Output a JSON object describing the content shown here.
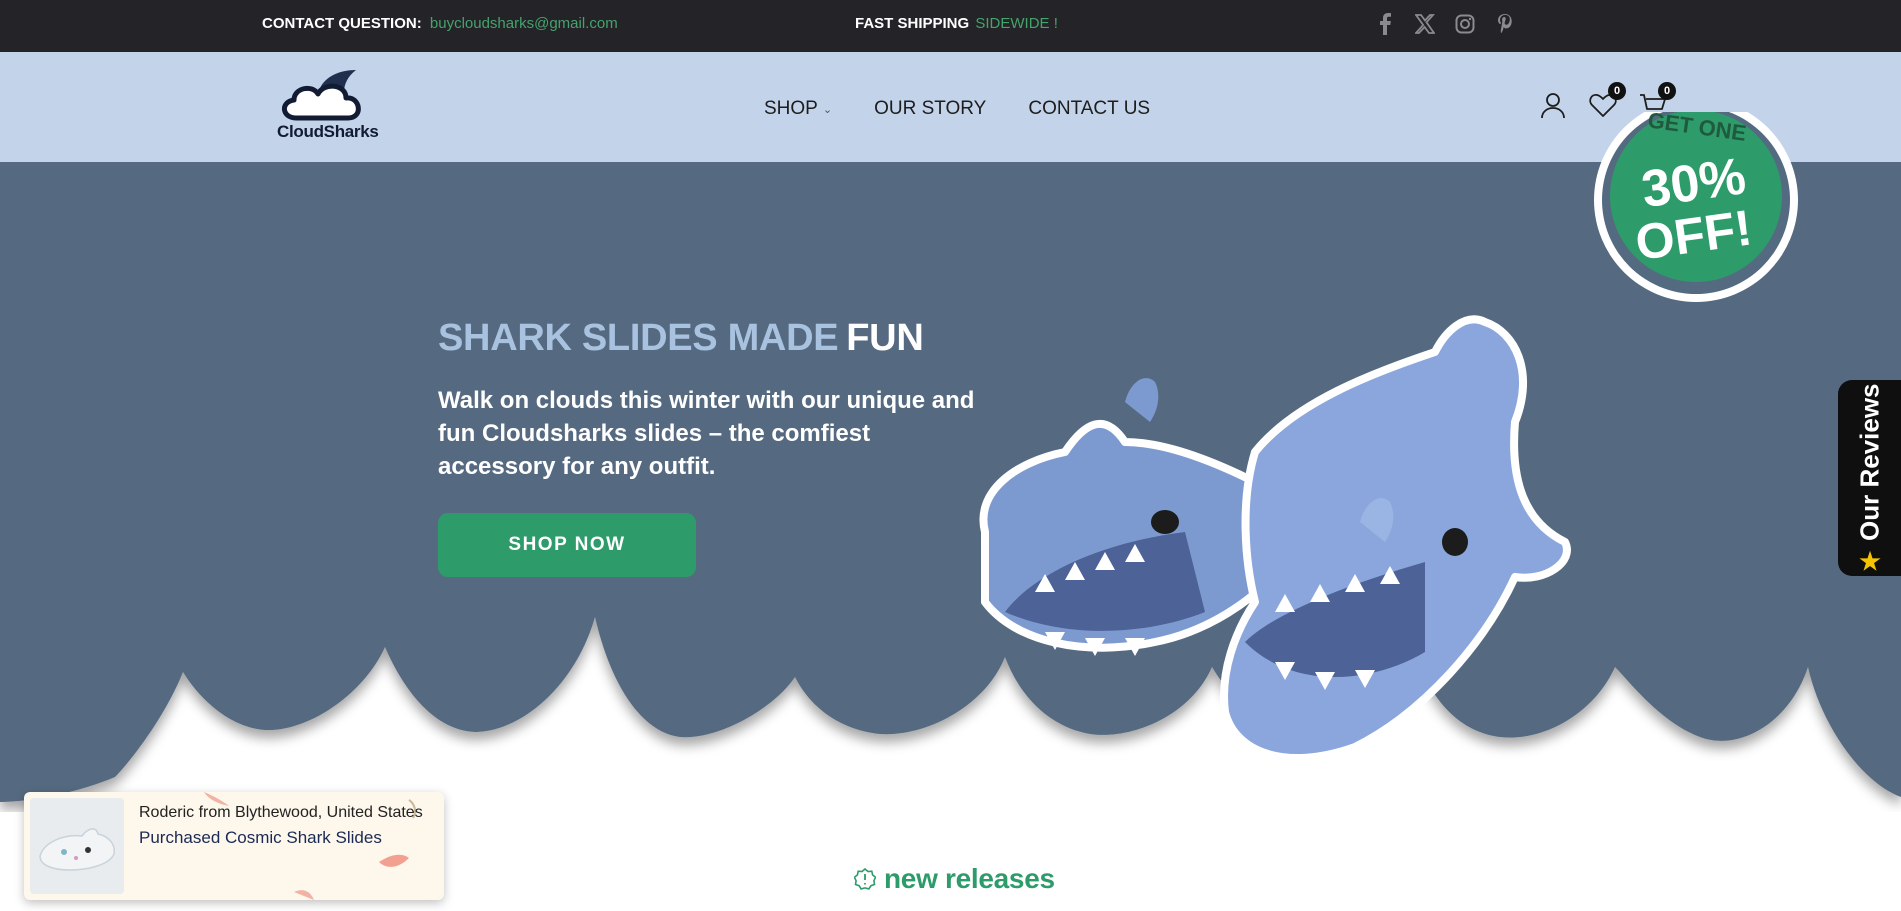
{
  "topbar": {
    "contact_label": "CONTACT QUESTION:",
    "contact_email": "buycloudsharks@gmail.com",
    "shipping_label": "FAST SHIPPING",
    "shipping_highlight": "SIDEWIDE !",
    "social_icons": [
      "facebook-icon",
      "x-twitter-icon",
      "instagram-icon",
      "pinterest-icon"
    ]
  },
  "header": {
    "logo_text": "CloudSharks",
    "nav": [
      {
        "label": "SHOP",
        "has_dropdown": true
      },
      {
        "label": "OUR STORY"
      },
      {
        "label": "CONTACT US"
      }
    ],
    "wishlist_count": "0",
    "cart_count": "0",
    "icons": [
      "account-icon",
      "heart-icon",
      "cart-icon"
    ]
  },
  "hero": {
    "title_main": "SHARK SLIDES MADE",
    "title_accent": "FUN",
    "subtitle": "Walk on clouds this winter with our unique and fun Cloudsharks slides – the comfiest accessory for any outfit.",
    "cta_label": "SHOP NOW",
    "promo_top": "GET ONE",
    "promo_main": "30%",
    "promo_bottom": "OFF!"
  },
  "reviews_tab": {
    "label": "Our Reviews",
    "icon": "star-icon"
  },
  "popup": {
    "line1": "Roderic from Blythewood, United States",
    "line2": "Purchased Cosmic Shark Slides"
  },
  "section": {
    "title": "new releases",
    "icon": "badge-icon"
  },
  "colors": {
    "topbar_bg": "#242328",
    "header_bg": "#c3d3ea",
    "hero_bg": "#546a80",
    "accent_green": "#2e9b6a",
    "title_light_blue": "#a9c2e0"
  }
}
